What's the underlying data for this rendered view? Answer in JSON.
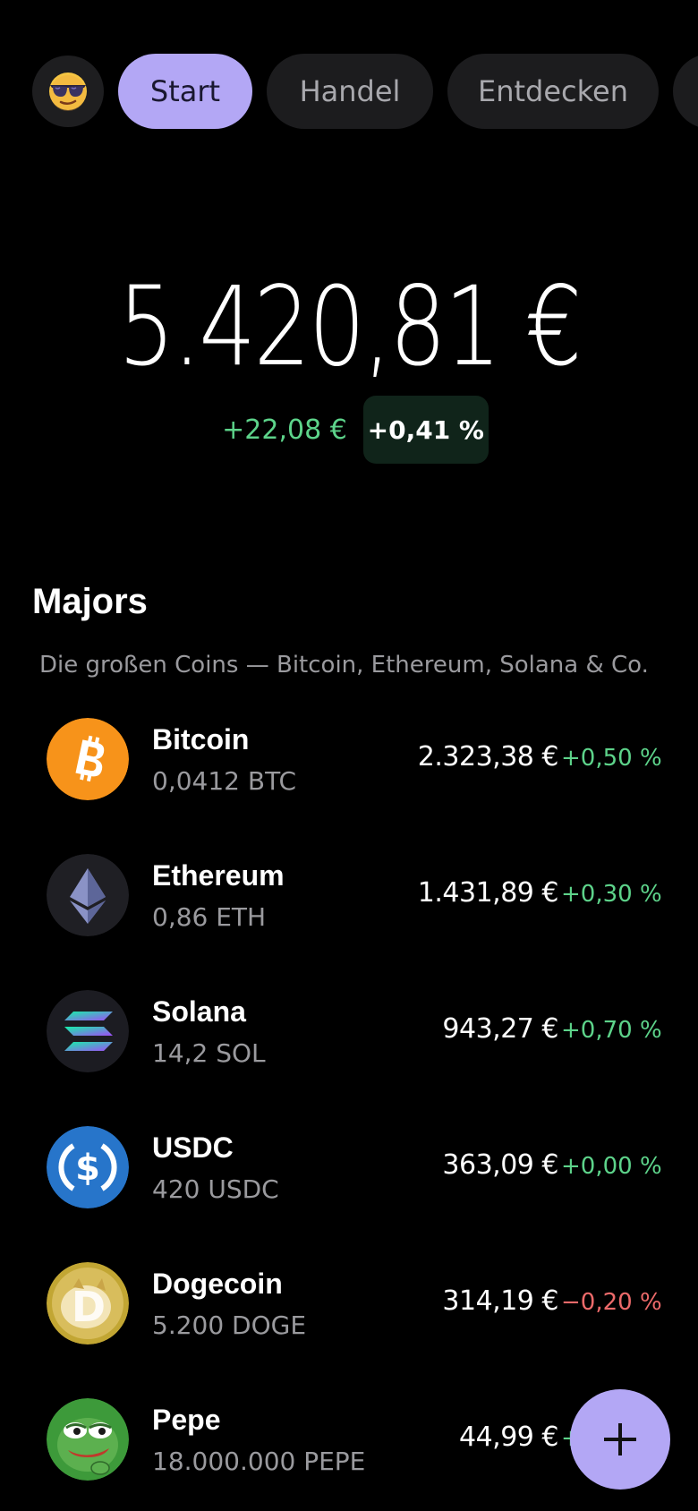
{
  "nav": {
    "avatar_emoji": "😎",
    "tabs": [
      {
        "label": "Start",
        "active": true
      },
      {
        "label": "Handel",
        "active": false
      },
      {
        "label": "Entdecken",
        "active": false
      }
    ]
  },
  "balance": {
    "total": "5.420,81 €",
    "change_abs": "+22,08 €",
    "change_pct": "+0,41 %"
  },
  "section": {
    "title": "Majors",
    "subtitle": "Die großen Coins — Bitcoin, Ethereum, Solana & Co."
  },
  "coins": [
    {
      "name": "Bitcoin",
      "amount": "0,0412 BTC",
      "value": "2.323,38 €",
      "change": "+0,50 %",
      "trend": "up",
      "icon": "bitcoin-icon"
    },
    {
      "name": "Ethereum",
      "amount": "0,86 ETH",
      "value": "1.431,89 €",
      "change": "+0,30 %",
      "trend": "up",
      "icon": "ethereum-icon"
    },
    {
      "name": "Solana",
      "amount": "14,2 SOL",
      "value": "943,27 €",
      "change": "+0,70 %",
      "trend": "up",
      "icon": "solana-icon"
    },
    {
      "name": "USDC",
      "amount": "420 USDC",
      "value": "363,09 €",
      "change": "+0,00 %",
      "trend": "up",
      "icon": "usdc-icon"
    },
    {
      "name": "Dogecoin",
      "amount": "5.200 DOGE",
      "value": "314,19 €",
      "change": "−0,20 %",
      "trend": "down",
      "icon": "dogecoin-icon"
    },
    {
      "name": "Pepe",
      "amount": "18.000.000 PEPE",
      "value": "44,99 €",
      "change": "+",
      "trend": "up",
      "icon": "pepe-icon"
    }
  ],
  "colors": {
    "accent": "#b3a7f5",
    "positive": "#5dd38a",
    "negative": "#ec6a6a",
    "background": "#000000",
    "pill": "#1c1c1e"
  }
}
